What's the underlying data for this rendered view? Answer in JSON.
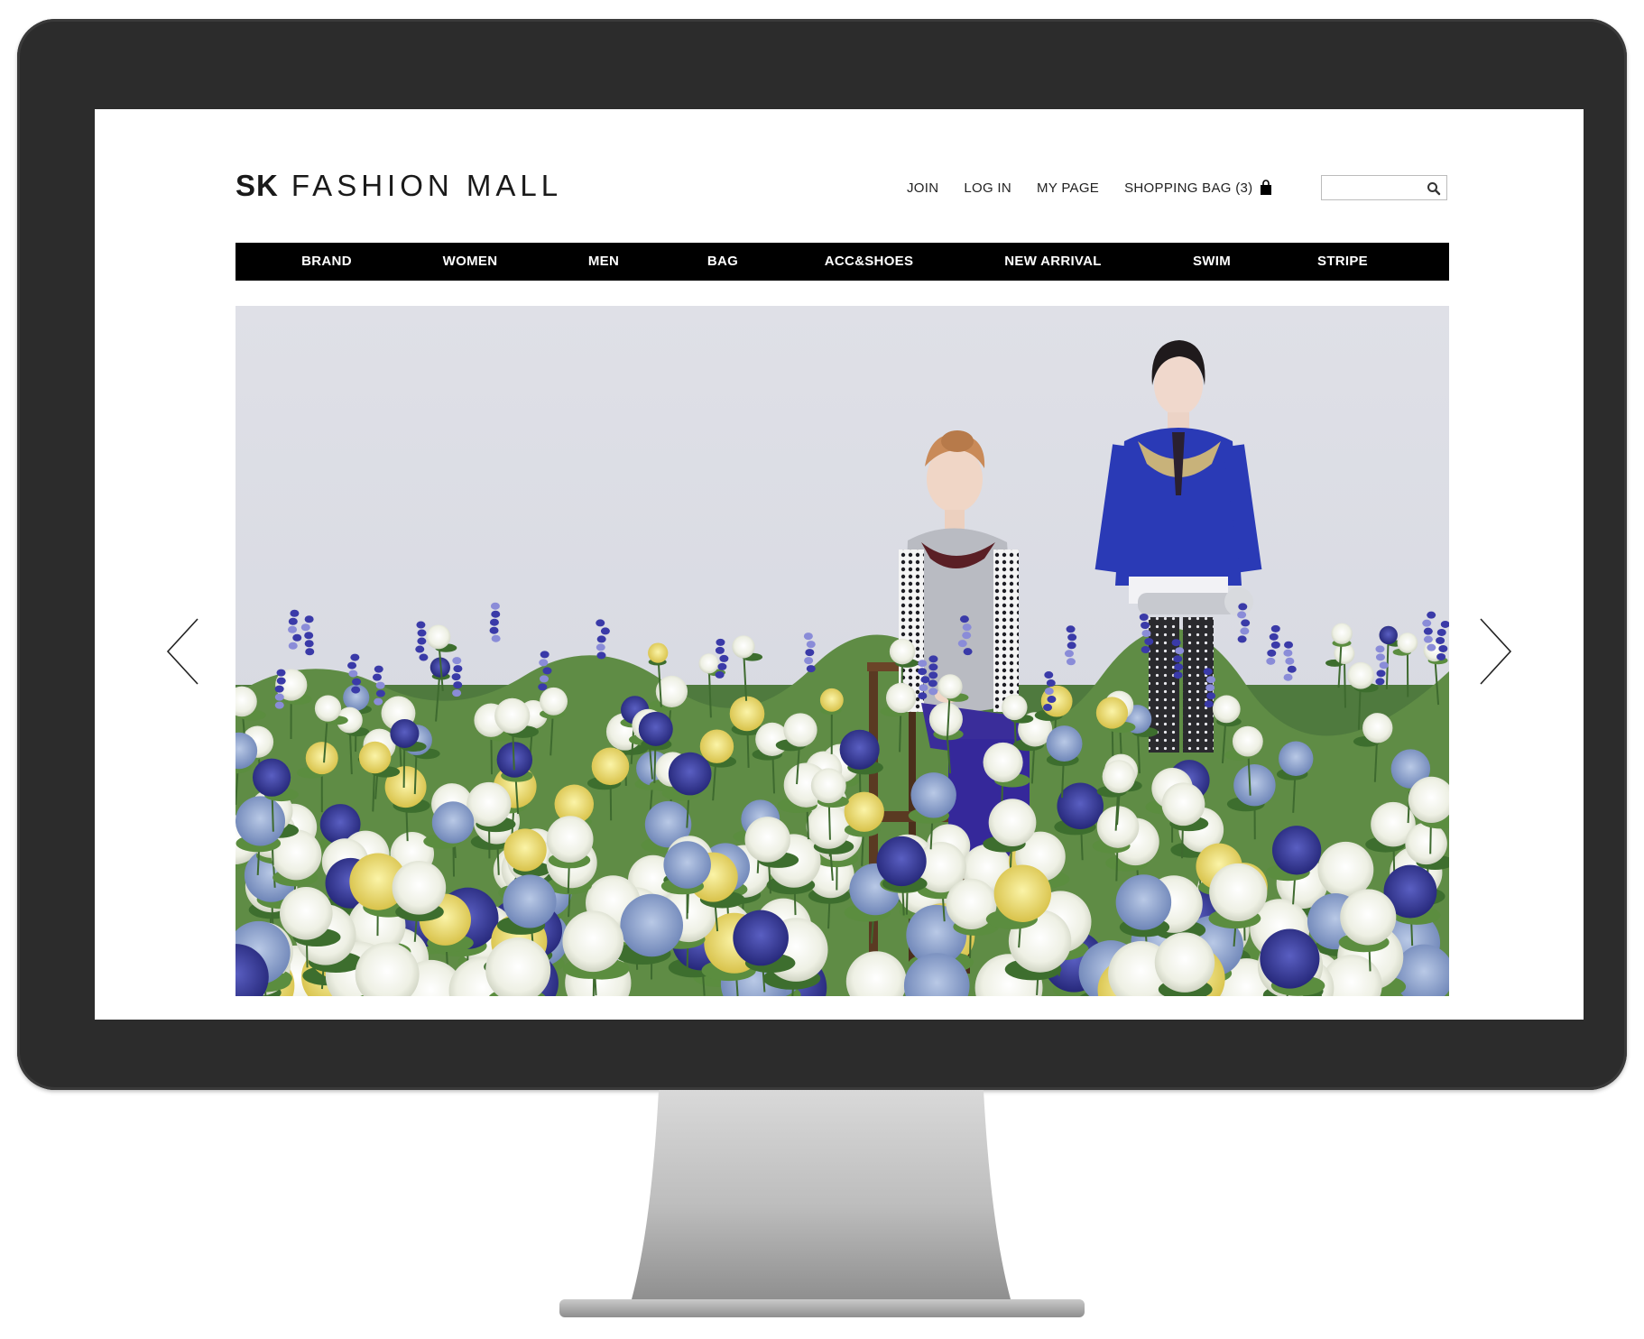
{
  "brand": {
    "bold": "SK",
    "light": "FASHION MALL"
  },
  "top_links": {
    "join": "JOIN",
    "login": "LOG IN",
    "my_page": "MY PAGE",
    "shopping_bag": "SHOPPING BAG (3)",
    "bag_icon": "shopping-bag-icon"
  },
  "search": {
    "value": "",
    "icon": "search-icon"
  },
  "nav": {
    "items": [
      {
        "label": "BRAND"
      },
      {
        "label": "WOMEN"
      },
      {
        "label": "MEN"
      },
      {
        "label": "BAG"
      },
      {
        "label": "ACC&SHOES"
      },
      {
        "label": "NEW ARRIVAL"
      },
      {
        "label": "SWIM"
      },
      {
        "label": "STRIPE"
      }
    ]
  },
  "carousel": {
    "prev_icon": "chevron-left-icon",
    "next_icon": "chevron-right-icon"
  },
  "colors": {
    "nav_background": "#000000",
    "nav_text": "#ffffff",
    "monitor_bezel": "#2c2c2c",
    "hero_background": "#dfe0e7"
  }
}
